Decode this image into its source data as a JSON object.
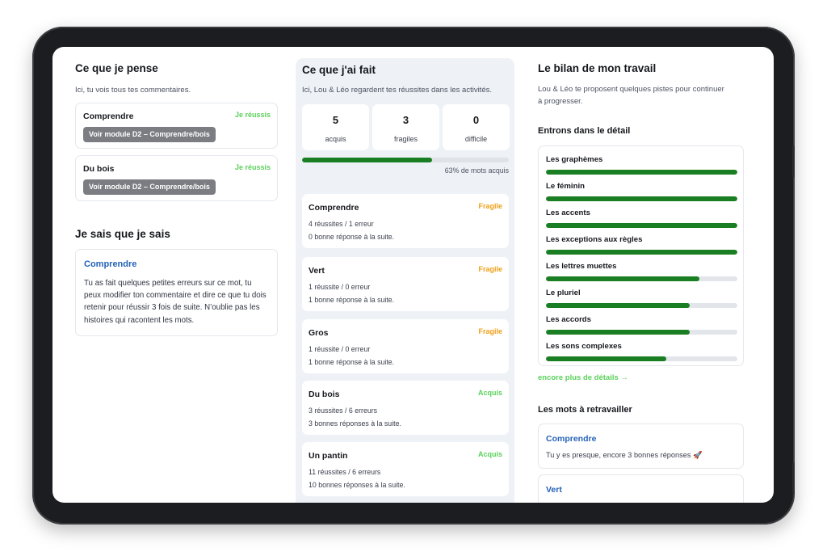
{
  "column_thoughts": {
    "title": "Ce que je pense",
    "subtitle": "Ici, tu vois tous tes commentaires.",
    "comments": [
      {
        "title": "Comprendre",
        "status": "Je réussis",
        "button": "Voir module D2 – Comprendre/bois"
      },
      {
        "title": "Du bois",
        "status": "Je réussis",
        "button": "Voir module D2 – Comprendre/bois"
      }
    ],
    "know_title": "Je sais que je sais",
    "know_card": {
      "title": "Comprendre",
      "text": "Tu as fait quelques petites erreurs sur ce mot, tu peux modifier ton commentaire et dire ce que tu dois retenir pour réussir 3 fois de suite. N’oublie pas les histoires qui racontent les mots."
    }
  },
  "column_done": {
    "title": "Ce que j'ai fait",
    "subtitle": "Ici, Lou & Léo regardent tes réussites dans les activités.",
    "stats": [
      {
        "value": "5",
        "label": "acquis"
      },
      {
        "value": "3",
        "label": "fragiles"
      },
      {
        "value": "0",
        "label": "difficile"
      }
    ],
    "progress_fraction": 0.63,
    "progress_label": "63% de mots acquis",
    "activities": [
      {
        "title": "Comprendre",
        "status": "Fragile",
        "line1": "4 réussites / 1 erreur",
        "line2": "0 bonne réponse à la suite."
      },
      {
        "title": "Vert",
        "status": "Fragile",
        "line1": "1 réussite / 0 erreur",
        "line2": "1 bonne réponse à la suite."
      },
      {
        "title": "Gros",
        "status": "Fragile",
        "line1": "1 réussite / 0 erreur",
        "line2": "1 bonne réponse à la suite."
      },
      {
        "title": "Du bois",
        "status": "Acquis",
        "line1": "3 réussites / 6 erreurs",
        "line2": "3 bonnes réponses à la suite."
      },
      {
        "title": "Un pantin",
        "status": "Acquis",
        "line1": "11 réussites / 6 erreurs",
        "line2": "10 bonnes réponses à la suite."
      }
    ]
  },
  "column_review": {
    "title": "Le bilan de mon travail",
    "subtitle_line1": "Lou & Léo te proposent quelques pistes pour continuer",
    "subtitle_line2": "à progresser.",
    "detail_title": "Entrons dans le détail",
    "skills": [
      {
        "name": "Les graphèmes",
        "level": 1.0
      },
      {
        "name": "Le féminin",
        "level": 1.0
      },
      {
        "name": "Les accents",
        "level": 1.0
      },
      {
        "name": "Les exceptions aux règles",
        "level": 1.0
      },
      {
        "name": "Les lettres muettes",
        "level": 0.8
      },
      {
        "name": "Le pluriel",
        "level": 0.75
      },
      {
        "name": "Les accords",
        "level": 0.75
      },
      {
        "name": "Les sons complexes",
        "level": 0.63
      }
    ],
    "more_link": "encore plus de détails →",
    "rework_title": "Les mots à retravailler",
    "rework_words": [
      {
        "title": "Comprendre",
        "text": "Tu y es presque, encore 3 bonnes réponses 🚀"
      },
      {
        "title": "Vert",
        "text": ""
      }
    ]
  },
  "colors": {
    "accent_blue": "#2562b7",
    "success_green": "#5bd15b",
    "warning_orange": "#f0a01a",
    "progress_green": "#1a7f22"
  }
}
